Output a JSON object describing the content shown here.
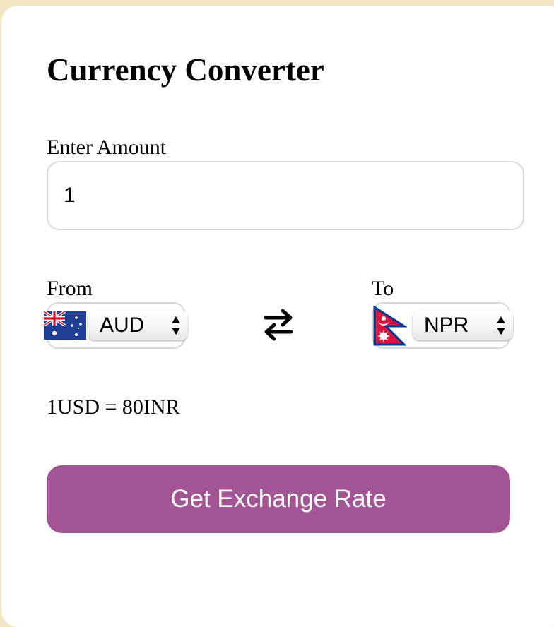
{
  "app": {
    "title": "Currency Converter"
  },
  "amount": {
    "label": "Enter Amount",
    "value": "1"
  },
  "from": {
    "label": "From",
    "currency": "AUD",
    "flag_icon": "australia-flag-icon"
  },
  "to": {
    "label": "To",
    "currency": "NPR",
    "flag_icon": "nepal-flag-icon"
  },
  "swap_icon": "swap-arrows-icon",
  "rate_message": "1USD = 80INR",
  "action": {
    "button_label": "Get Exchange Rate"
  },
  "colors": {
    "page_background": "#f3e6c3",
    "card_background": "#ffffff",
    "button_background": "#a35494",
    "button_text": "#ffffff"
  }
}
